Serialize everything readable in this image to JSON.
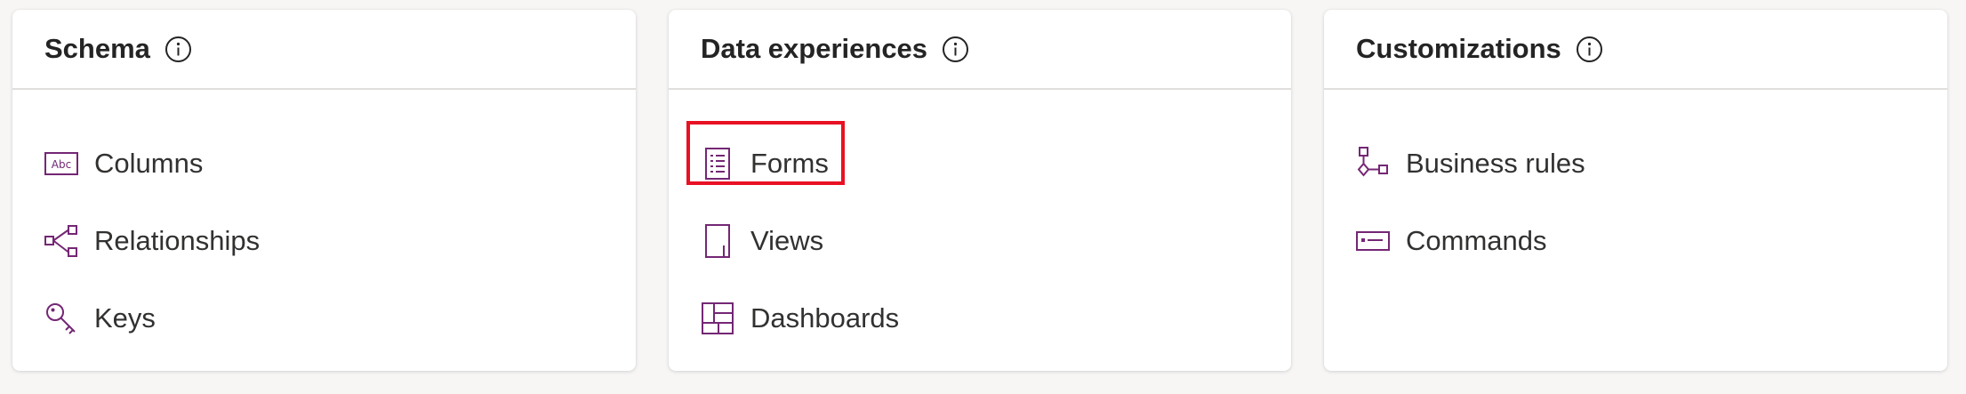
{
  "cards": {
    "schema": {
      "title": "Schema",
      "items": [
        {
          "label": "Columns",
          "icon": "columns-icon"
        },
        {
          "label": "Relationships",
          "icon": "relationships-icon"
        },
        {
          "label": "Keys",
          "icon": "keys-icon"
        }
      ]
    },
    "data_experiences": {
      "title": "Data experiences",
      "items": [
        {
          "label": "Forms",
          "icon": "forms-icon"
        },
        {
          "label": "Views",
          "icon": "views-icon"
        },
        {
          "label": "Dashboards",
          "icon": "dashboards-icon"
        }
      ]
    },
    "customizations": {
      "title": "Customizations",
      "items": [
        {
          "label": "Business rules",
          "icon": "business-rules-icon"
        },
        {
          "label": "Commands",
          "icon": "commands-icon"
        }
      ]
    }
  },
  "colors": {
    "icon_accent": "#742774",
    "highlight": "#e81123",
    "divider": "#e1dfdd"
  }
}
